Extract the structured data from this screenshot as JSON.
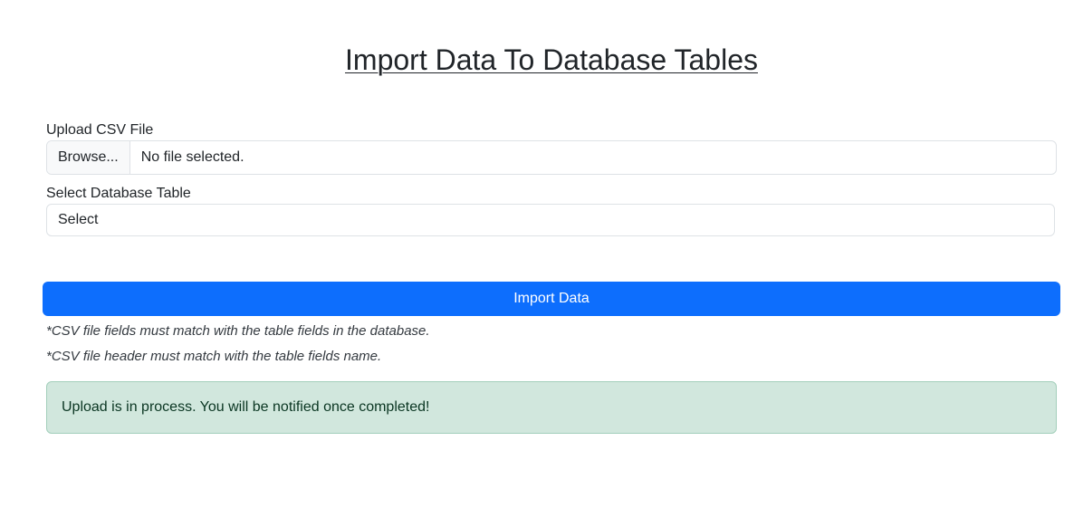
{
  "page": {
    "title": "Import Data To Database Tables"
  },
  "upload": {
    "label": "Upload CSV File",
    "browse_label": "Browse...",
    "status": "No file selected."
  },
  "table_select": {
    "label": "Select Database Table",
    "value": "Select"
  },
  "import_button": {
    "label": "Import Data",
    "color": "#0d6efd"
  },
  "notes": [
    "*CSV file fields must match with the table fields in the database.",
    "*CSV file header must match with the table fields name."
  ],
  "alert": {
    "message": "Upload is in process. You will be notified once completed!",
    "background": "#d1e7dd",
    "text_color": "#0a3622"
  }
}
